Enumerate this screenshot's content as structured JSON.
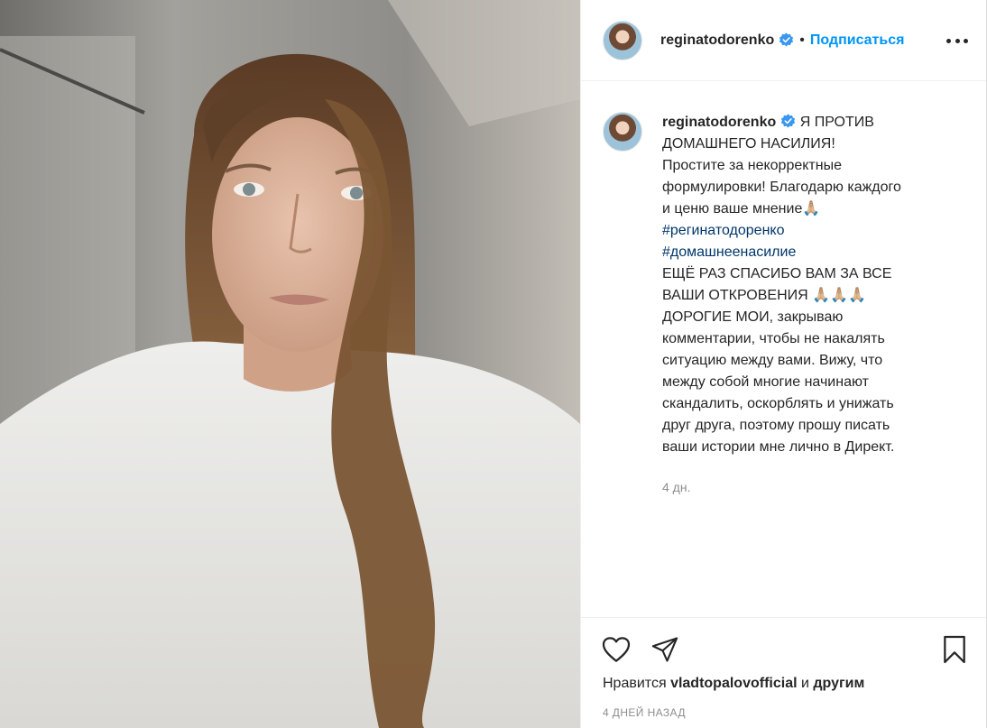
{
  "post": {
    "username": "reginatodorenko",
    "separator": "•",
    "follow_label": "Подписаться",
    "caption_lines": [
      "Я ПРОТИВ",
      "ДОМАШНЕГО НАСИЛИЯ!",
      "Простите за некорректные",
      "формулировки! Благодарю каждого",
      "и ценю ваше мнение🙏🏼"
    ],
    "hashtags": [
      "#регинатодоренко",
      "#домашнеенасилие"
    ],
    "caption_lines_2": [
      "ЕЩЁ РАЗ СПАСИБО ВАМ ЗА ВСЕ",
      "ВАШИ ОТКРОВЕНИЯ 🙏🏼🙏🏼🙏🏼",
      "ДОРОГИЕ МОИ, закрываю",
      "комментарии, чтобы не накалять",
      "ситуацию между вами. Вижу, что",
      "между собой многие начинают",
      "скандалить, оскорблять и унижать",
      "друг друга, поэтому прошу писать",
      "ваши истории мне лично в Директ."
    ],
    "time_ago": "4 дн.",
    "likes_prefix": "Нравится",
    "likes_user": "vladtopalovofficial",
    "likes_and": "и",
    "likes_others": "другим",
    "date": "4 ДНЕЙ НАЗАД"
  },
  "colors": {
    "accent": "#0095f6",
    "hashtag": "#00376b",
    "muted": "#8e8e8e",
    "verified": "#3897f0"
  },
  "icons": [
    "more-options-icon",
    "verified-badge-icon",
    "like-heart-icon",
    "share-direct-icon",
    "save-bookmark-icon"
  ]
}
